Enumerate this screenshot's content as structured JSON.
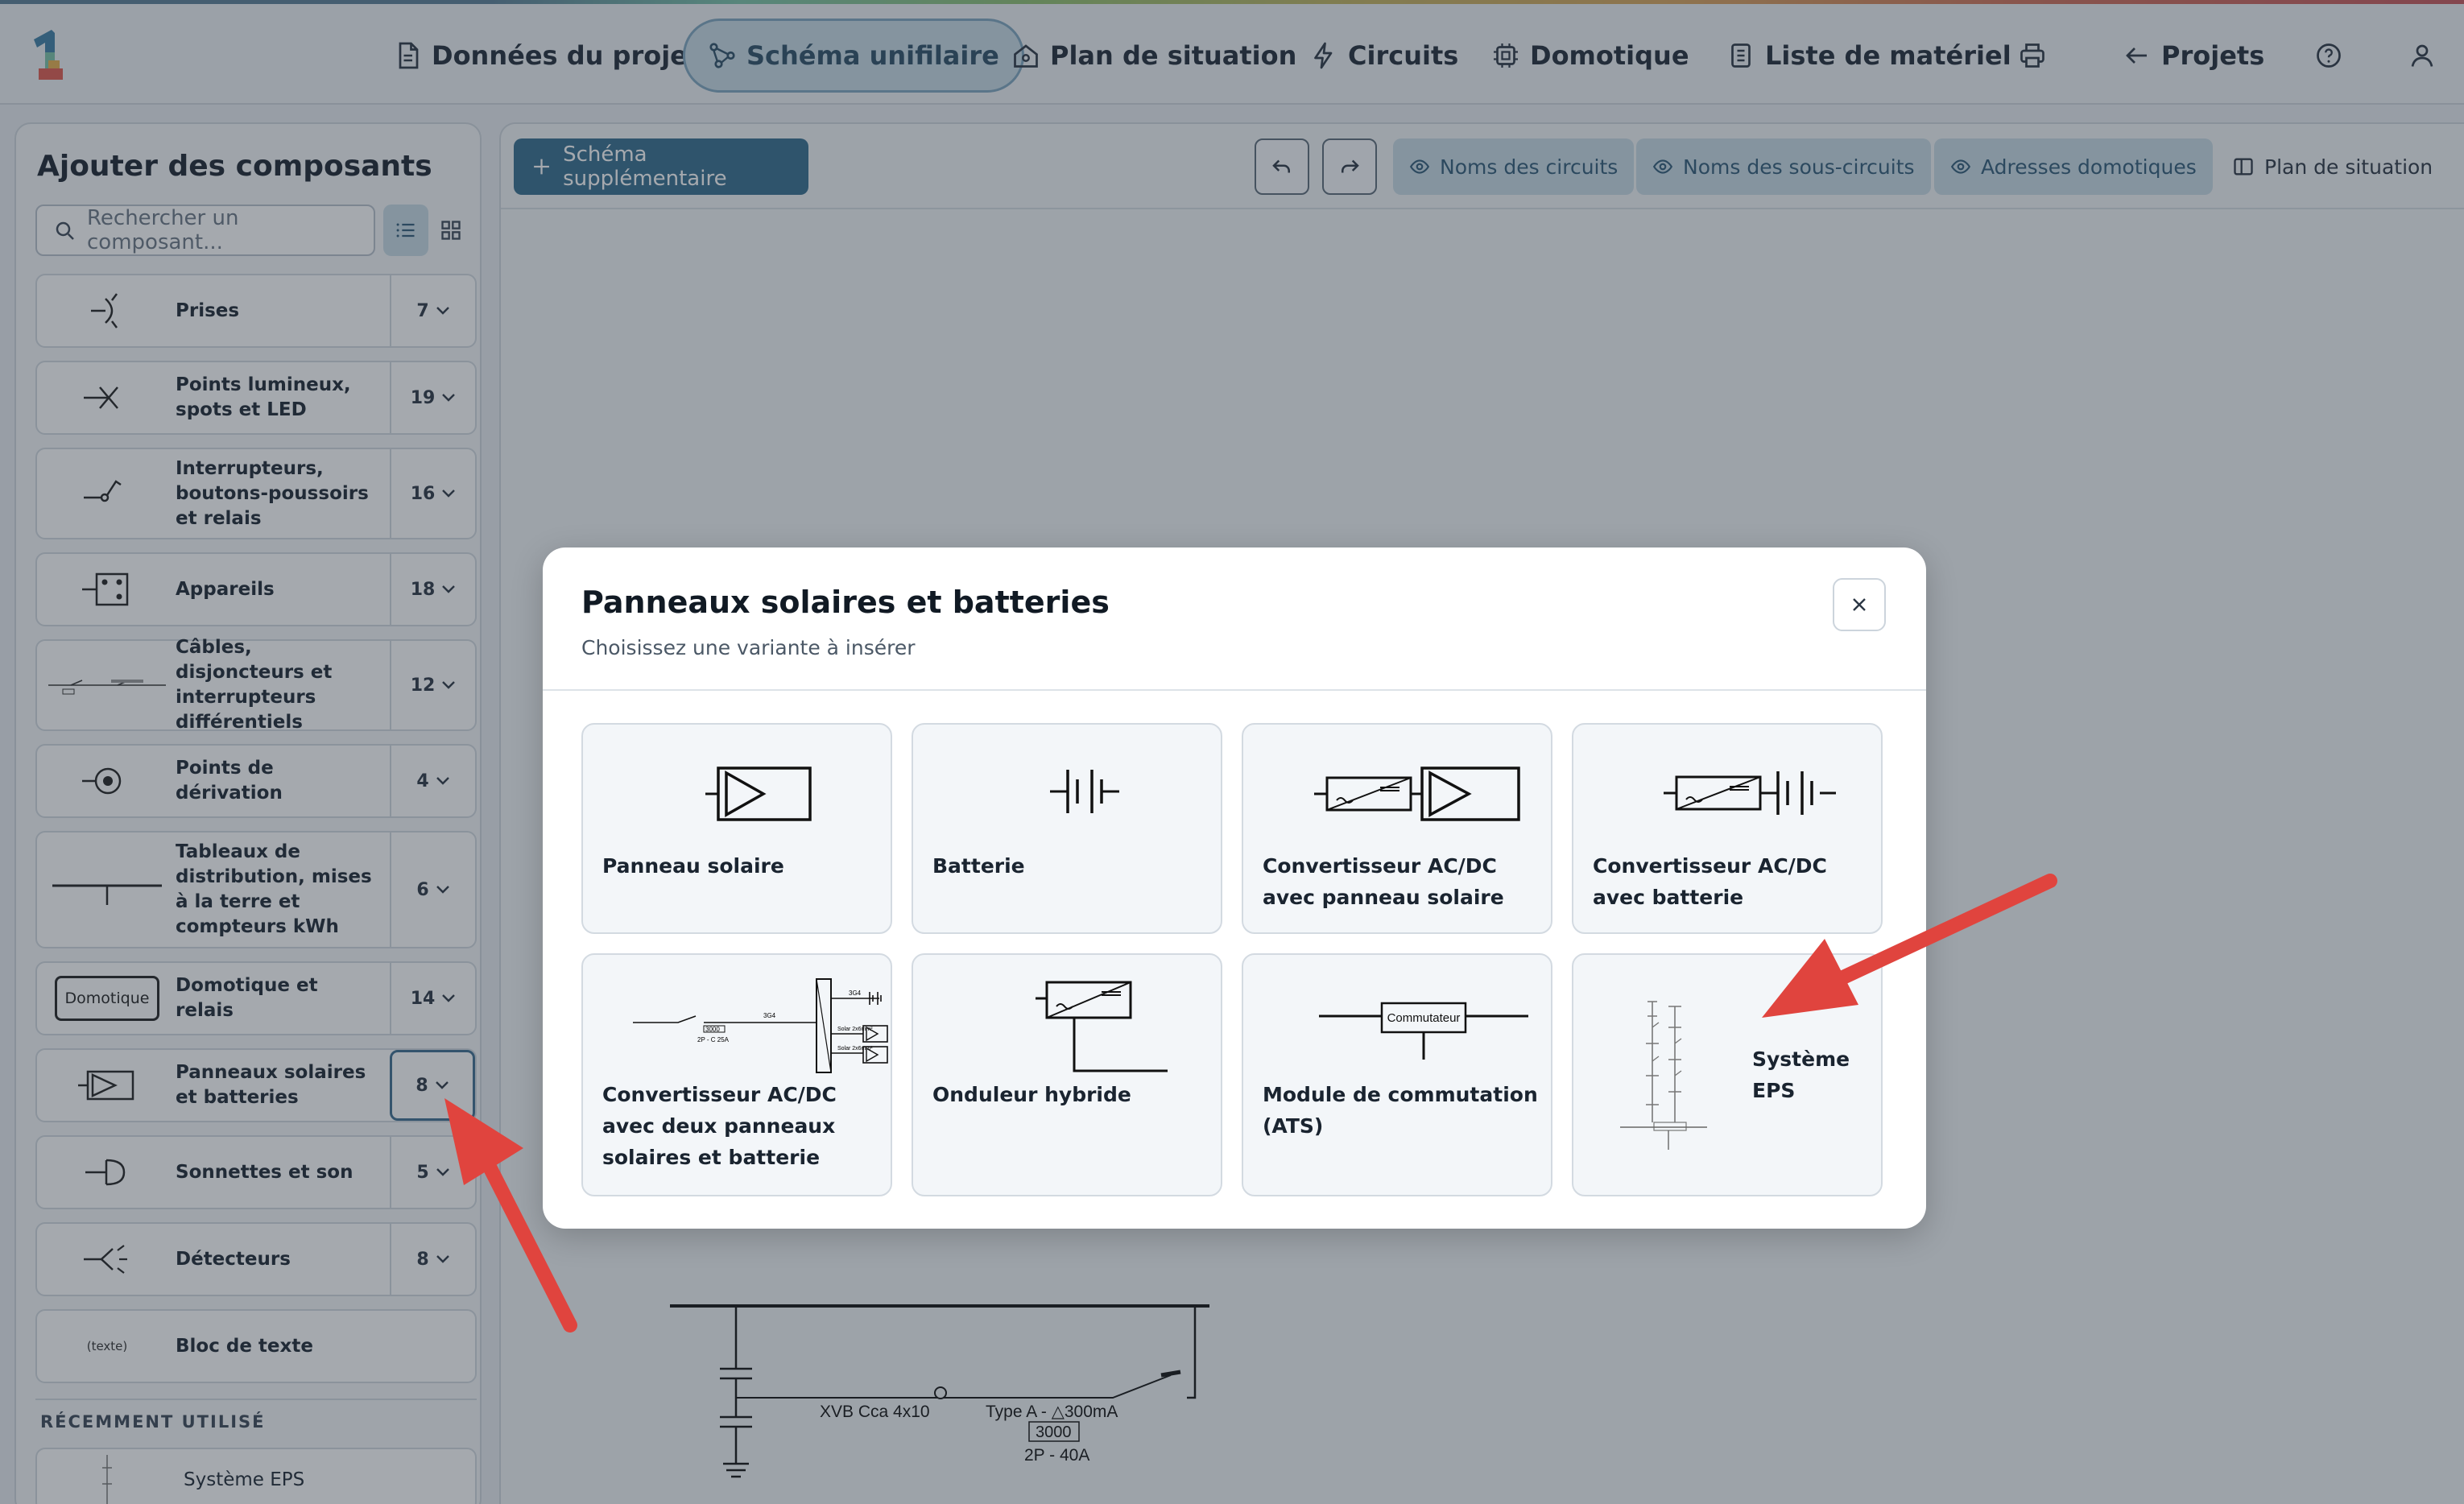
{
  "topbar": {
    "nav": [
      {
        "label": "Données du projet",
        "icon": "document-icon"
      },
      {
        "label": "Schéma unifilaire",
        "icon": "schematic-icon",
        "active": true
      },
      {
        "label": "Plan de situation",
        "icon": "house-icon"
      },
      {
        "label": "Circuits",
        "icon": "lightning-icon"
      },
      {
        "label": "Domotique",
        "icon": "chip-icon"
      },
      {
        "label": "Liste de matériel",
        "icon": "list-icon"
      },
      {
        "label": "",
        "icon": "print-icon"
      },
      {
        "label": "Projets",
        "icon": "arrow-left-icon"
      },
      {
        "label": "",
        "icon": "help-icon"
      },
      {
        "label": "",
        "icon": "user-icon"
      }
    ]
  },
  "sidebar": {
    "title": "Ajouter des composants",
    "search_placeholder": "Rechercher un composant...",
    "categories": [
      {
        "label": "Prises",
        "count": "7"
      },
      {
        "label": "Points lumineux, spots et LED",
        "count": "19"
      },
      {
        "label": "Interrupteurs, boutons-poussoirs et relais",
        "count": "16"
      },
      {
        "label": "Appareils",
        "count": "18"
      },
      {
        "label": "Câbles, disjoncteurs et interrupteurs différentiels",
        "count": "12"
      },
      {
        "label": "Points de dérivation",
        "count": "4"
      },
      {
        "label": "Tableaux de distribution, mises à la terre et compteurs kWh",
        "count": "6"
      },
      {
        "label": "Domotique et relais",
        "count": "14",
        "symbol_text": "Domotique"
      },
      {
        "label": "Panneaux solaires et batteries",
        "count": "8",
        "selected": true
      },
      {
        "label": "Sonnettes et son",
        "count": "5"
      },
      {
        "label": "Détecteurs",
        "count": "8"
      },
      {
        "label": "Bloc de texte",
        "symbol_text": "(texte)"
      }
    ],
    "recent_title": "RÉCEMMENT UTILISÉ",
    "recent": [
      {
        "label": "Système EPS"
      }
    ]
  },
  "toolbar": {
    "add_schema": "Schéma supplémentaire",
    "show_circuit_names": "Noms des circuits",
    "show_subcircuit_names": "Noms des sous-circuits",
    "show_domotic_addresses": "Adresses domotiques",
    "situation_plan": "Plan de situation"
  },
  "schematic": {
    "cable_label": "XVB Cca 4x10",
    "breaker_type": "Type A -  △300mA",
    "breaker_value": "3000",
    "breaker_rating": "2P - 40A"
  },
  "modal": {
    "title": "Panneaux solaires et batteries",
    "subtitle": "Choisissez une variante à insérer",
    "variants": [
      {
        "label": "Panneau solaire"
      },
      {
        "label": "Batterie"
      },
      {
        "label": "Convertisseur AC/DC avec panneau solaire"
      },
      {
        "label": "Convertisseur AC/DC avec batterie"
      },
      {
        "label": "Convertisseur AC/DC avec deux panneaux solaires et batterie"
      },
      {
        "label": "Onduleur hybride"
      },
      {
        "label": "Module de commutation (ATS)",
        "symbol_text": "Commutateur"
      },
      {
        "label": "Système EPS"
      }
    ],
    "mini_schematic_labels": {
      "cable_a": "3G4",
      "cable_b": "3G4",
      "solar_a": "Solar 2x6mm²",
      "solar_b": "Solar 2x6mm²",
      "breaker_value": "3000",
      "breaker_rating": "2P - C 25A"
    }
  },
  "colors": {
    "accent": "#356d8e",
    "accent_light": "#c9dbe6",
    "arrow": "#e0443e"
  }
}
